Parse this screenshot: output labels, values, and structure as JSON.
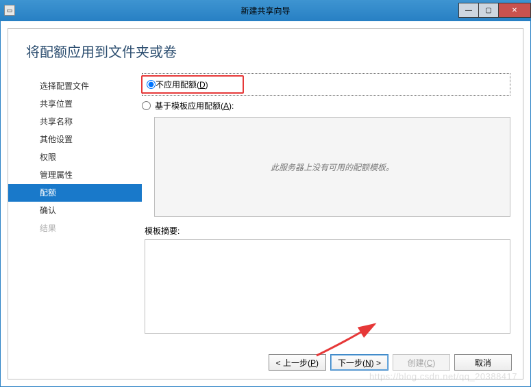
{
  "titlebar": {
    "title": "新建共享向导"
  },
  "page": {
    "heading": "将配额应用到文件夹或卷"
  },
  "sidebar": {
    "items": [
      {
        "label": "选择配置文件",
        "state": "normal"
      },
      {
        "label": "共享位置",
        "state": "normal"
      },
      {
        "label": "共享名称",
        "state": "normal"
      },
      {
        "label": "其他设置",
        "state": "normal"
      },
      {
        "label": "权限",
        "state": "normal"
      },
      {
        "label": "管理属性",
        "state": "normal"
      },
      {
        "label": "配额",
        "state": "selected"
      },
      {
        "label": "确认",
        "state": "normal"
      },
      {
        "label": "结果",
        "state": "disabled"
      }
    ]
  },
  "options": {
    "no_quota_prefix": "不应用配额(",
    "no_quota_key": "D",
    "no_quota_suffix": ")",
    "template_prefix": "基于模板应用配额(",
    "template_key": "A",
    "template_suffix": "):",
    "selected": "no_quota"
  },
  "template_panel": {
    "empty_message": "此服务器上没有可用的配额模板。"
  },
  "summary": {
    "label": "模板摘要:"
  },
  "buttons": {
    "prev_prefix": "< 上一步(",
    "prev_key": "P",
    "prev_suffix": ")",
    "next_prefix": "下一步(",
    "next_key": "N",
    "next_suffix": ") >",
    "create_prefix": "创建(",
    "create_key": "C",
    "create_suffix": ")",
    "cancel": "取消"
  },
  "watermark": "https://blog.csdn.net/qq_20388417"
}
